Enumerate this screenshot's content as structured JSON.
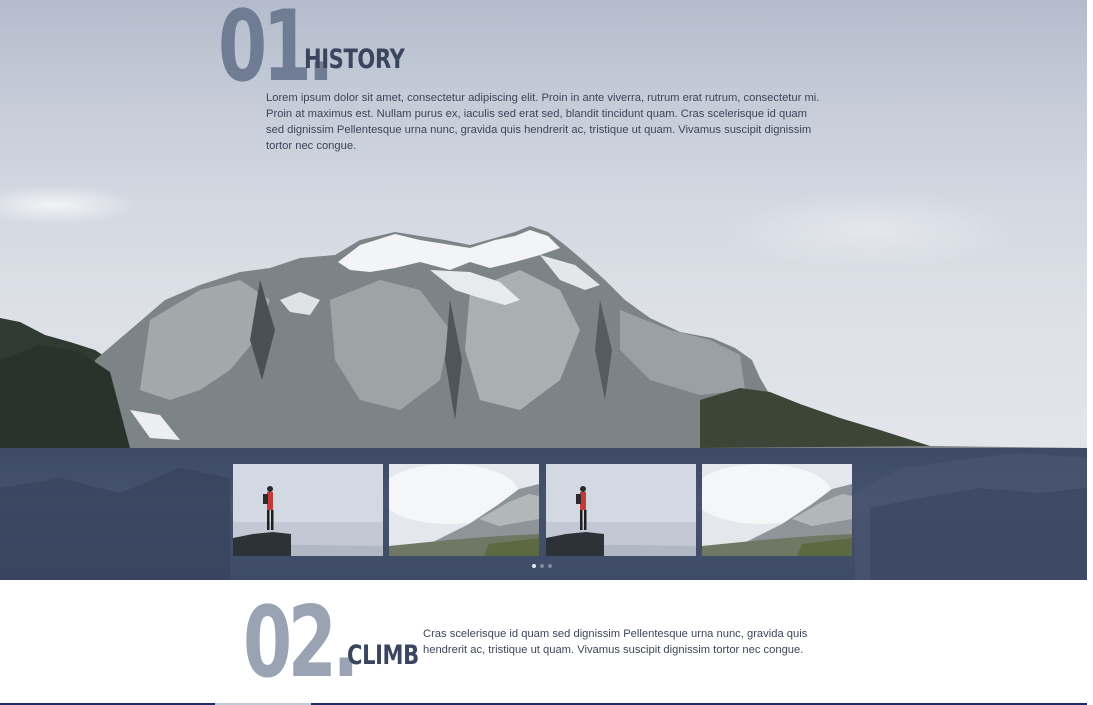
{
  "section1": {
    "number": "01",
    "dot": ".",
    "title": "HISTORY",
    "body": "Lorem ipsum dolor sit amet, consectetur adipiscing elit. Proin in ante viverra, rutrum erat rutrum, consectetur mi. Proin at maximus est. Nullam purus ex, iaculis sed erat sed, blandit tincidunt quam. Cras scelerisque id quam sed dignissim Pellentesque urna nunc, gravida quis hendrerit ac, tristique ut quam. Vivamus suscipit dignissim tortor nec congue."
  },
  "gallery": {
    "thumbnails": [
      {
        "icon": "hiker-on-cliff-image"
      },
      {
        "icon": "cloudy-mountain-image"
      },
      {
        "icon": "hiker-on-cliff-image"
      },
      {
        "icon": "cloudy-mountain-image"
      }
    ],
    "pager": {
      "count": 3,
      "active_index": 0
    }
  },
  "section2": {
    "number": "02",
    "dot": ".",
    "title": "CLIMB",
    "body": "Cras scelerisque id quam sed dignissim Pellentesque urna nunc, gravida quis hendrerit ac, tristique ut quam. Vivamus suscipit dignissim tortor nec congue."
  },
  "colors": {
    "heading": "#3a4660",
    "number_dark": "#6f7c93",
    "number_light": "#9aa3b3",
    "strip": "#424f6b",
    "accent_line": "#1f2a6a"
  }
}
